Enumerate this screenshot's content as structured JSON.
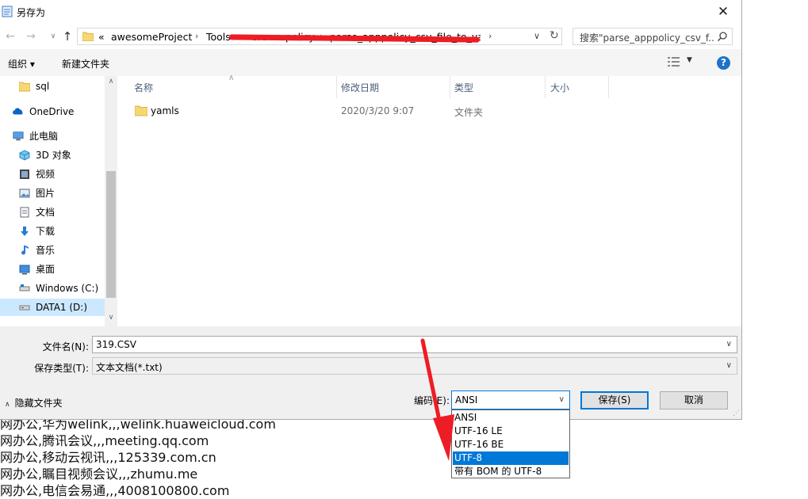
{
  "window": {
    "title": "另存为",
    "close_glyph": "✕"
  },
  "address": {
    "crumbs": [
      "«",
      "awesomeProject",
      "Tools",
      "src",
      "policy",
      "parse_apppolicy_csv_file_to_yaml"
    ],
    "search_placeholder": "搜索\"parse_apppolicy_csv_f..."
  },
  "toolbar": {
    "organize": "组织 ▾",
    "new_folder": "新建文件夹",
    "help": "?"
  },
  "nav": {
    "items": [
      {
        "label": "sql",
        "icon": "folder-icon"
      },
      {
        "label": "OneDrive",
        "icon": "cloud-icon"
      },
      {
        "label": "此电脑",
        "icon": "computer-icon"
      },
      {
        "label": "3D 对象",
        "icon": "cube-icon"
      },
      {
        "label": "视频",
        "icon": "video-icon"
      },
      {
        "label": "图片",
        "icon": "picture-icon"
      },
      {
        "label": "文档",
        "icon": "document-icon"
      },
      {
        "label": "下载",
        "icon": "download-icon"
      },
      {
        "label": "音乐",
        "icon": "music-icon"
      },
      {
        "label": "桌面",
        "icon": "desktop-icon"
      },
      {
        "label": "Windows (C:)",
        "icon": "drive-icon"
      },
      {
        "label": "DATA1 (D:)",
        "icon": "drive-icon"
      }
    ]
  },
  "files": {
    "columns": [
      "名称",
      "修改日期",
      "类型",
      "大小"
    ],
    "rows": [
      {
        "name": "yamls",
        "date": "2020/3/20 9:07",
        "type": "文件夹",
        "size": ""
      }
    ]
  },
  "form": {
    "filename_label": "文件名(N):",
    "filename_value": "319.CSV",
    "filetype_label": "保存类型(T):",
    "filetype_value": "文本文档(*.txt)",
    "hide_folders": "隐藏文件夹",
    "encoding_label": "编码(E):",
    "encoding_value": "ANSI",
    "encoding_options": [
      "ANSI",
      "UTF-16 LE",
      "UTF-16 BE",
      "UTF-8",
      "带有 BOM 的 UTF-8"
    ],
    "encoding_highlighted": "UTF-8",
    "save_button": "保存(S)",
    "cancel_button": "取消"
  },
  "background_text": [
    "网办公,华为welink,,,welink.huaweicloud.com",
    "网办公,腾讯会议,,,meeting.qq.com",
    "网办公,移动云视讯,,,125339.com.cn",
    "网办公,瞩目视频会议,,,zhumu.me",
    "网办公,电信会易通,,,4008100800.com"
  ],
  "colors": {
    "accent": "#0078d7",
    "annotation": "#ee1c25",
    "selected_nav": "#cce8ff"
  }
}
